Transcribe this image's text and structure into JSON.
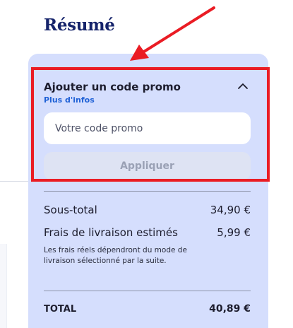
{
  "summary": {
    "title": "Résumé"
  },
  "promo": {
    "heading": "Ajouter un code promo",
    "more_info_link": "Plus d'infos",
    "input_placeholder": "Votre code promo",
    "input_value": "",
    "apply_label": "Appliquer",
    "apply_enabled": false,
    "expanded": true,
    "toggle_icon": "chevron-up-icon"
  },
  "totals": {
    "subtotal_label": "Sous-total",
    "subtotal_value": "34,90 €",
    "shipping_label": "Frais de livraison estimés",
    "shipping_value": "5,99 €",
    "shipping_note": "Les frais réels dépendront du mode de livraison sélectionné par la suite.",
    "total_label": "TOTAL",
    "total_value": "40,89 €"
  },
  "annotation": {
    "highlight_color": "#ea1c24",
    "shape": "rectangle with arrow"
  },
  "colors": {
    "title": "#16246b",
    "card_background": "#d5defd",
    "link": "#1f61d6",
    "button_disabled_bg": "#dee3f3",
    "button_disabled_text": "#9aa1b5"
  }
}
